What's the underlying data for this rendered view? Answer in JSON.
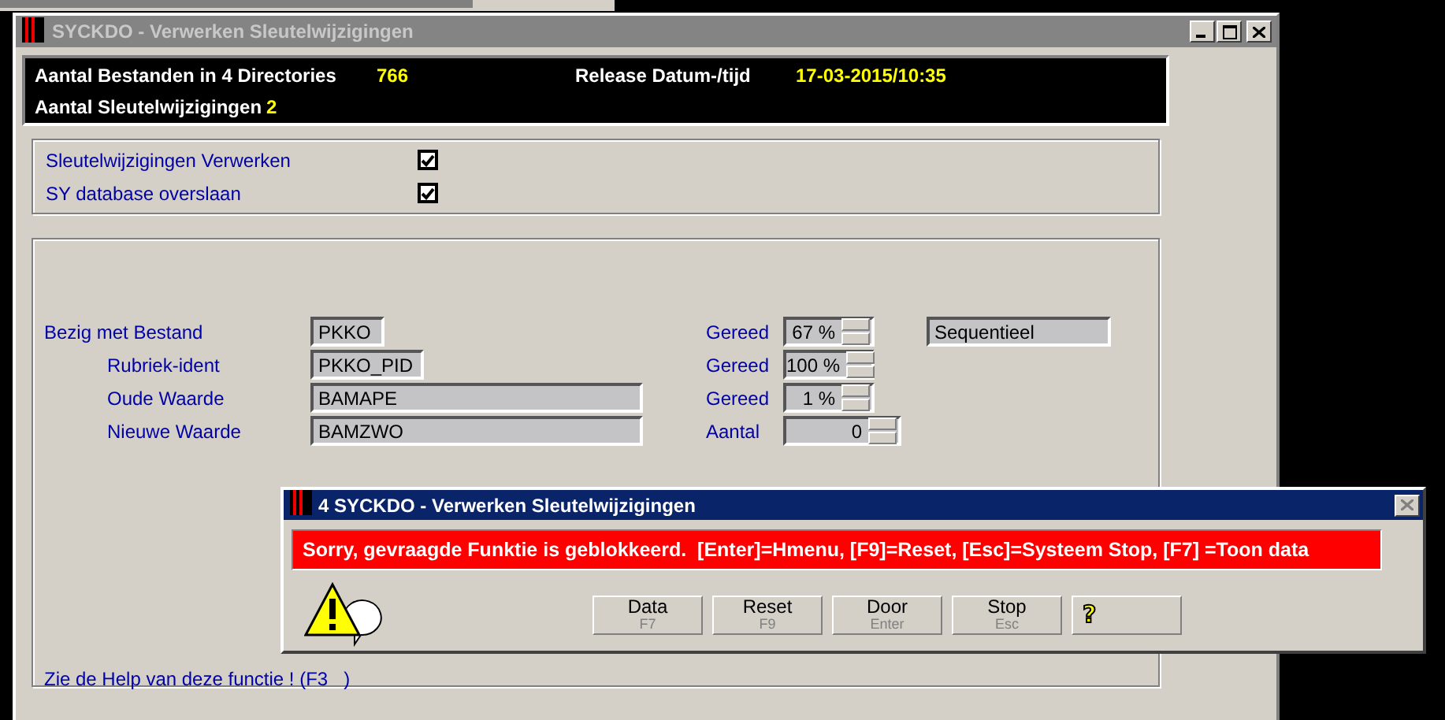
{
  "window": {
    "title": "SYCKDO - Verwerken Sleutelwijzigingen"
  },
  "info": {
    "files_label": "Aantal Bestanden in 4 Directories",
    "files_value": "766",
    "release_label": "Release Datum-/tijd",
    "release_value": "17-03-2015/10:35",
    "changes_label": "Aantal Sleutelwijzigingen",
    "changes_value": "2"
  },
  "options": [
    {
      "label": "Sleutelwijzigingen Verwerken",
      "checked": true
    },
    {
      "label": "SY database overslaan",
      "checked": true
    }
  ],
  "fields": [
    {
      "label": "Bezig met Bestand",
      "value": "PKKO",
      "children": [
        {
          "label": "Rubriek-ident",
          "value": "PKKO_PID"
        },
        {
          "label": "Oude Waarde",
          "value": "BAMAPE"
        },
        {
          "label": "Nieuwe Waarde",
          "value": "BAMZWO"
        }
      ]
    }
  ],
  "progress": [
    {
      "label": "Gereed",
      "value": "67 %"
    },
    {
      "label": "Gereed",
      "value": "100 %"
    },
    {
      "label": "Gereed",
      "value": "1 %"
    },
    {
      "label": "Aantal",
      "value": "0"
    }
  ],
  "mode": {
    "value": "Sequentieel"
  },
  "help_text": "Zie de Help van deze functie ! (F3   )",
  "dialog": {
    "title": "4 SYCKDO - Verwerken Sleutelwijzigingen",
    "message": "Sorry, gevraagde Funktie is geblokkeerd.  [Enter]=Hmenu, [F9]=Reset, [Esc]=Systeem Stop, [F7] =Toon data",
    "buttons": [
      {
        "kind": "key",
        "label": "Data",
        "key": "F7"
      },
      {
        "kind": "key",
        "label": "Reset",
        "key": "F9"
      },
      {
        "kind": "key",
        "label": "Door",
        "key": "Enter"
      },
      {
        "kind": "key",
        "label": "Stop",
        "key": "Esc"
      },
      {
        "kind": "help",
        "label": "?"
      }
    ]
  }
}
